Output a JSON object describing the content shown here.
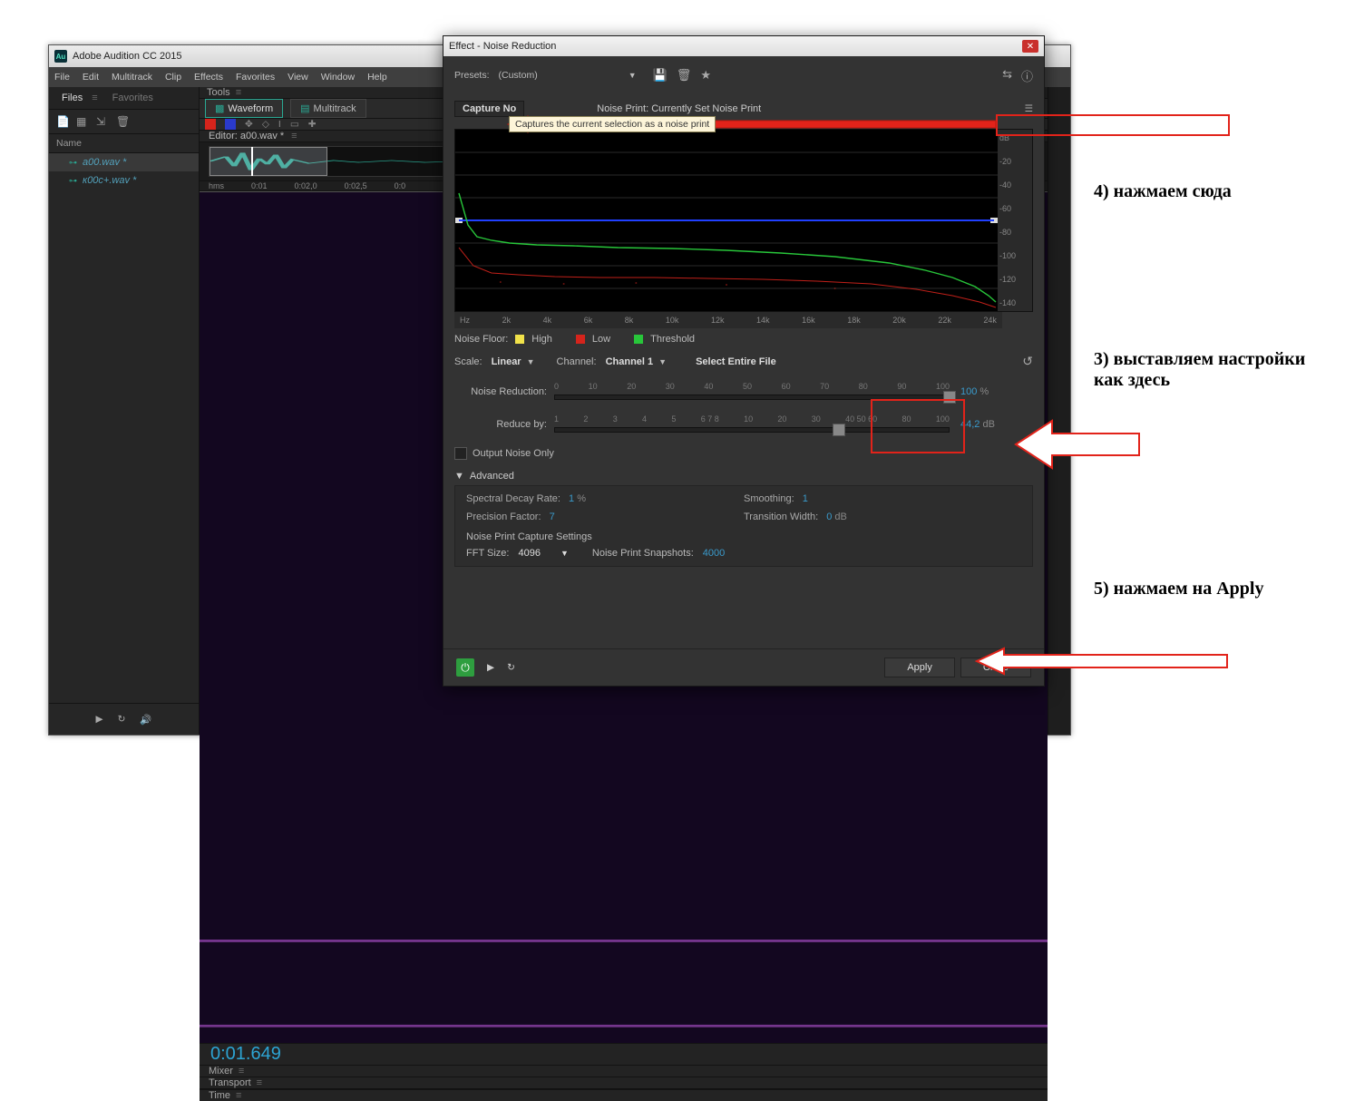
{
  "main_window": {
    "title": "Adobe Audition CC 2015",
    "menu": [
      "File",
      "Edit",
      "Multitrack",
      "Clip",
      "Effects",
      "Favorites",
      "View",
      "Window",
      "Help"
    ],
    "panels": {
      "files": "Files",
      "favorites": "Favorites",
      "tools": "Tools",
      "name_hdr": "Name"
    },
    "files": [
      "a00.wav *",
      "к00с+.wav *"
    ],
    "modes": {
      "waveform": "Waveform",
      "multitrack": "Multitrack"
    },
    "editor_label": "Editor: a00.wav *",
    "timeline": {
      "unit": "hms",
      "ticks": [
        "0:01",
        "0:02,0",
        "0:02,5",
        "0:0"
      ]
    },
    "timecode": "0:01.649",
    "mixer": "Mixer",
    "transport": "Transport",
    "time": "Time"
  },
  "dialog": {
    "title": "Effect - Noise Reduction",
    "preset_label": "Presets:",
    "preset_value": "(Custom)",
    "capture_label": "Capture No",
    "noise_print_label": "Noise Print:  Currently Set Noise Print",
    "tooltip": "Captures the current selection as a noise print",
    "yaxis": [
      "dB",
      "-20",
      "-40",
      "-60",
      "-80",
      "-100",
      "-120",
      "-140"
    ],
    "xaxis": [
      "Hz",
      "2k",
      "4k",
      "6k",
      "8k",
      "10k",
      "12k",
      "14k",
      "16k",
      "18k",
      "20k",
      "22k",
      "24k"
    ],
    "noise_floor_label": "Noise Floor:",
    "legend": {
      "high": "High",
      "low": "Low",
      "threshold": "Threshold"
    },
    "scale_label": "Scale:",
    "scale_value": "Linear",
    "channel_label": "Channel:",
    "channel_value": "Channel 1",
    "select_entire": "Select Entire File",
    "nr_label": "Noise Reduction:",
    "nr_ticks": [
      "0",
      "10",
      "20",
      "30",
      "40",
      "50",
      "60",
      "70",
      "80",
      "90",
      "100"
    ],
    "nr_value": "100",
    "nr_unit": "%",
    "rb_label": "Reduce by:",
    "rb_ticks": [
      "1",
      "2",
      "3",
      "4",
      "5",
      "6 7 8",
      "10",
      "20",
      "30",
      "40 50 60",
      "80",
      "100"
    ],
    "rb_value": "44,2",
    "rb_unit": "dB",
    "output_noise": "Output Noise Only",
    "advanced": "Advanced",
    "spectral_decay_label": "Spectral Decay Rate:",
    "spectral_decay_value": "1",
    "spectral_decay_unit": "%",
    "precision_label": "Precision Factor:",
    "precision_value": "7",
    "smoothing_label": "Smoothing:",
    "smoothing_value": "1",
    "transition_label": "Transition Width:",
    "transition_value": "0",
    "transition_unit": "dB",
    "capture_settings": "Noise Print Capture Settings",
    "fft_label": "FFT Size:",
    "fft_value": "4096",
    "snapshots_label": "Noise Print Snapshots:",
    "snapshots_value": "4000",
    "apply": "Apply",
    "close": "Close"
  },
  "annotations": {
    "a3": "3) выставляем настройки как здесь",
    "a4": "4) нажмаем сюда",
    "a5": "5) нажмаем на Apply"
  },
  "colors": {
    "high": "#f1e24a",
    "low": "#d5241c",
    "threshold": "#28c63a",
    "blue": "#3a9acb"
  }
}
